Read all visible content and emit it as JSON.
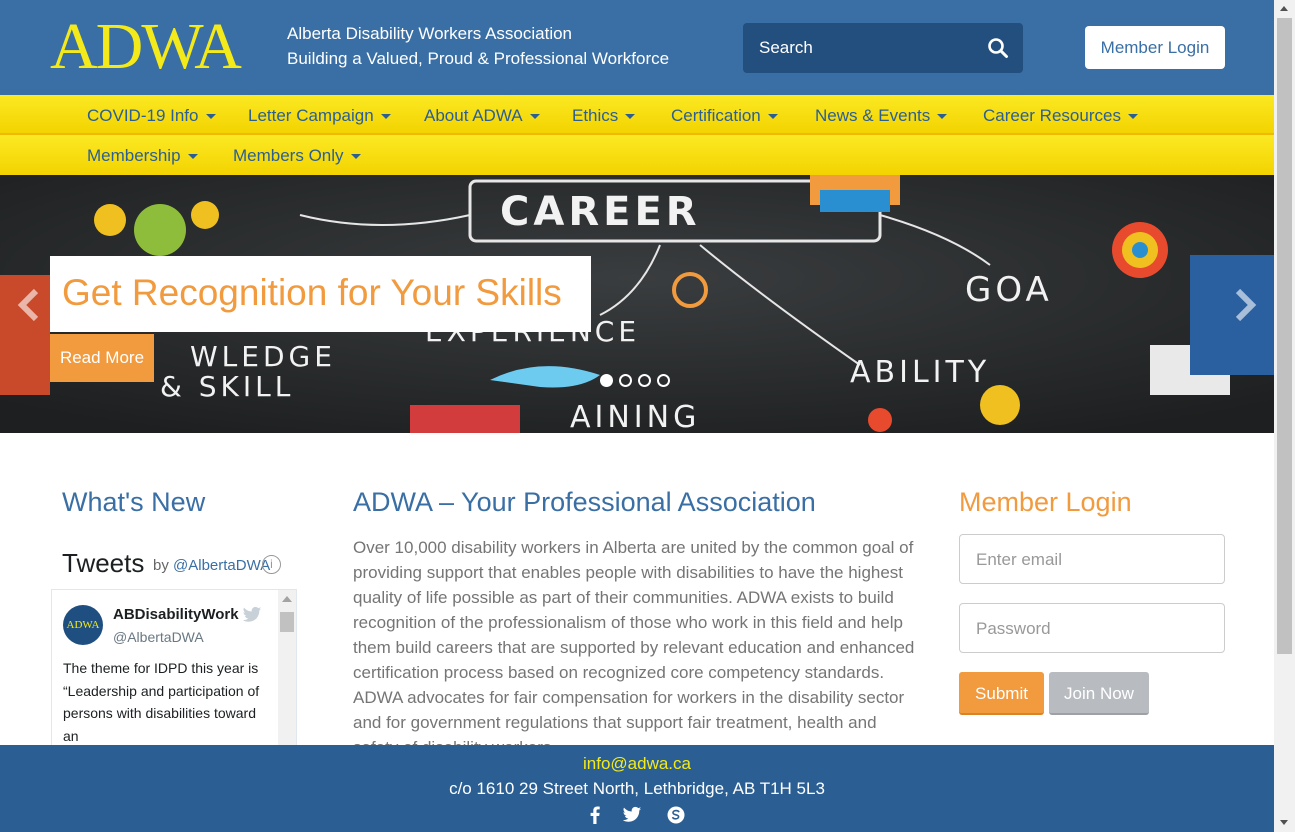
{
  "header": {
    "logo": "ADWA",
    "org_name": "Alberta Disability Workers Association",
    "slogan": "Building a Valued, Proud & Professional Workforce",
    "search_placeholder": "Search",
    "member_login": "Member Login"
  },
  "nav": {
    "row1": [
      "COVID-19 Info",
      "Letter Campaign",
      "About ADWA",
      "Ethics",
      "Certification",
      "News & Events",
      "Career Resources"
    ],
    "row2": [
      "Membership",
      "Members Only"
    ]
  },
  "hero": {
    "title": "Get Recognition for Your Skills",
    "button": "Read More",
    "chalk_words": [
      "CAREER",
      "EXPERIENCE",
      "WLEDGE",
      "& SKILL",
      "GOA",
      "ABILITY",
      "AINING"
    ],
    "slides": 4,
    "active_slide": 1
  },
  "whats_new": {
    "title": "What's New",
    "tweets_label": "Tweets",
    "by": "by",
    "handle": "@AlbertaDWA",
    "info": "i",
    "tweet": {
      "avatar_text": "ADWA",
      "name": "ABDisabilityWork",
      "handle": "@AlbertaDWA",
      "text": "The theme for IDPD this year is “Leadership and participation of persons with disabilities toward an"
    }
  },
  "main": {
    "title": "ADWA – Your Professional Association",
    "body": "Over 10,000 disability workers in Alberta are united by the common goal of providing support that enables people with disabilities to have the highest quality of life possible as part of their communities. ADWA exists to build recognition of the professionalism of those who work in this field and help them build careers that are supported by relevant education and enhanced certification process based on recognized core competency standards. ADWA advocates for fair compensation for workers in the disability sector and for government regulations that support fair treatment, health and safety of disability workers."
  },
  "login": {
    "title": "Member Login",
    "email_placeholder": "Enter email",
    "password_placeholder": "Password",
    "submit": "Submit",
    "join": "Join Now"
  },
  "footer": {
    "email": "info@adwa.ca",
    "address": "c/o 1610 29 Street North, Lethbridge, AB  T1H 5L3",
    "social_icons": [
      "facebook-icon",
      "twitter-icon",
      "skype-icon"
    ]
  },
  "colors": {
    "header_blue": "#3a6fa5",
    "nav_yellow": "#f5db0a",
    "accent_orange": "#f19a3e",
    "logo_yellow": "#f4ea1a",
    "footer_blue": "#2b5f93"
  }
}
